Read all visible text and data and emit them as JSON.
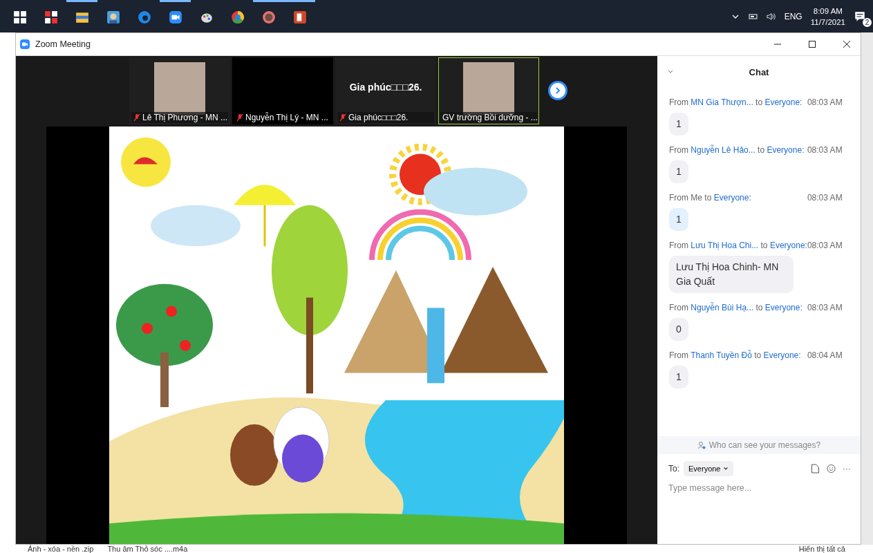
{
  "taskbar": {
    "apps": [
      {
        "kind": "start",
        "open": false
      },
      {
        "kind": "grid",
        "open": false
      },
      {
        "kind": "folder",
        "open": true
      },
      {
        "kind": "avatar",
        "open": false
      },
      {
        "kind": "browser",
        "open": false
      },
      {
        "kind": "camera",
        "open": true
      },
      {
        "kind": "palette",
        "open": false
      },
      {
        "kind": "circle",
        "open": false
      },
      {
        "kind": "face",
        "open": true
      },
      {
        "kind": "slides",
        "open": true
      }
    ],
    "tray": {
      "language": "ENG",
      "time": "8:09 AM",
      "date": "11/7/2021",
      "notifications": "2"
    }
  },
  "window": {
    "title": "Zoom Meeting"
  },
  "participants": [
    {
      "name": "Lê Thị Phương - MN ...",
      "kind": "photo",
      "muted": true,
      "speaking": false
    },
    {
      "name": "Nguyễn Thị Lý - MN ...",
      "kind": "blank",
      "muted": true,
      "speaking": false
    },
    {
      "name": "Gia phúc□□□26.",
      "kind": "name",
      "display": "Gia phúc□□□26.",
      "muted": true,
      "speaking": false
    },
    {
      "name": "GV trường Bồi dưỡng - ...",
      "kind": "photo",
      "muted": false,
      "speaking": true
    }
  ],
  "chat": {
    "title": "Chat",
    "messages": [
      {
        "prefix": "From",
        "sender": "MN Gia Thượn...",
        "joiner": "to",
        "recipient": "Everyone:",
        "time": "08:03 AM",
        "text": "1",
        "self": false
      },
      {
        "prefix": "From",
        "sender": "Nguyễn Lê Hảo...",
        "joiner": "to",
        "recipient": "Everyone:",
        "time": "08:03 AM",
        "text": "1",
        "self": false
      },
      {
        "prefix": "From",
        "sender": "Me",
        "joiner": "to",
        "recipient": "Everyone:",
        "time": "08:03 AM",
        "text": "1",
        "self": true
      },
      {
        "prefix": "From",
        "sender": "Lưu Thị Hoa Chi...",
        "joiner": "to",
        "recipient": "Everyone:",
        "time": "08:03 AM",
        "text": "Lưu Thị Hoa Chinh- MN Gia Quất",
        "self": false
      },
      {
        "prefix": "From",
        "sender": "Nguyễn Bùi Hạ...",
        "joiner": "to",
        "recipient": "Everyone:",
        "time": "08:03 AM",
        "text": "0",
        "self": false
      },
      {
        "prefix": "From",
        "sender": "Thanh Tuyền Đỗ",
        "joiner": "to",
        "recipient": "Everyone:",
        "time": "08:04 AM",
        "text": "1",
        "self": false
      }
    ],
    "privacy_link": "Who can see your messages?",
    "to_label": "To:",
    "recipient_dropdown": "Everyone",
    "more": "···",
    "placeholder": "Type message here..."
  },
  "downloads": {
    "items": [
      "Ảnh - xóa - nền .zip",
      "Thu âm Thỏ sóc ....m4a"
    ],
    "show_all": "Hiển thị tất cả"
  }
}
